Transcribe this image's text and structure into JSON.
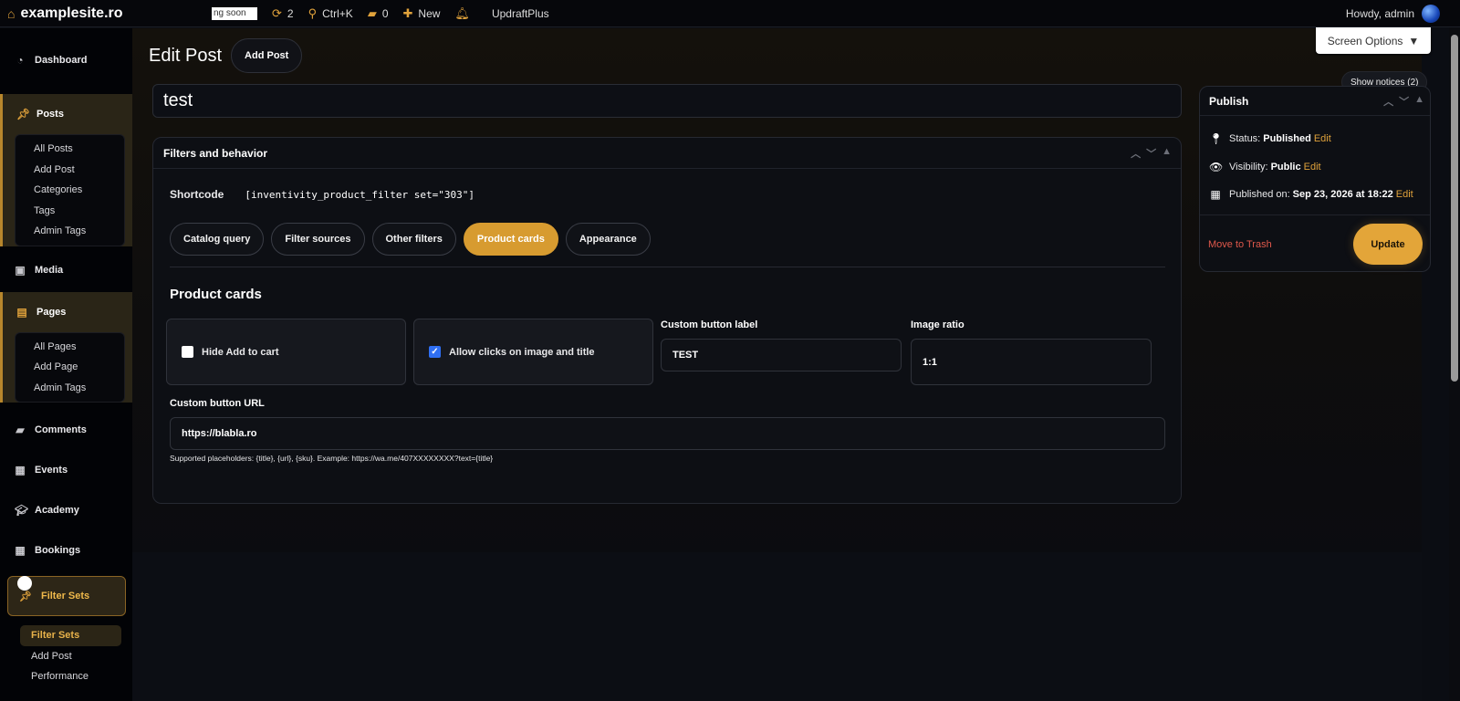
{
  "adminbar": {
    "site_name": "examplesite.ro",
    "coming_soon": "ng soon",
    "updates_count": "2",
    "search_shortcut": "Ctrl+K",
    "comments_count": "0",
    "new_label": "New",
    "plugin_label": "UpdraftPlus",
    "howdy": "Howdy, admin"
  },
  "sidebar": {
    "dashboard": "Dashboard",
    "posts": "Posts",
    "posts_sub": [
      "All Posts",
      "Add Post",
      "Categories",
      "Tags",
      "Admin Tags"
    ],
    "media": "Media",
    "pages": "Pages",
    "pages_sub": [
      "All Pages",
      "Add Page",
      "Admin Tags"
    ],
    "comments": "Comments",
    "events": "Events",
    "academy": "Academy",
    "bookings": "Bookings",
    "filter_sets": "Filter Sets",
    "filter_sets_sub": [
      "Filter Sets",
      "Add Post",
      "Performance"
    ]
  },
  "header": {
    "title": "Edit Post",
    "add_post": "Add Post",
    "screen_options": "Screen Options",
    "show_notices": "Show notices (2)"
  },
  "post_title": "test",
  "filters_box": {
    "title": "Filters and behavior",
    "shortcode_label": "Shortcode",
    "shortcode_value": "[inventivity_product_filter set=\"303\"]",
    "tabs": [
      "Catalog query",
      "Filter sources",
      "Other filters",
      "Product cards",
      "Appearance"
    ],
    "active_tab": "Product cards",
    "section_title": "Product cards",
    "hide_add_to_cart": "Hide Add to cart",
    "allow_clicks": "Allow clicks on image and title",
    "custom_button_label_label": "Custom button label",
    "custom_button_label_value": "TEST",
    "image_ratio_label": "Image ratio",
    "image_ratio_value": "1:1",
    "custom_button_url_label": "Custom button URL",
    "custom_button_url_value": "https://blabla.ro",
    "help_text": "Supported placeholders: {title}, {url}, {sku}. Example: https://wa.me/407XXXXXXXX?text={title}"
  },
  "publish": {
    "title": "Publish",
    "status_label": "Status:",
    "status_value": "Published",
    "visibility_label": "Visibility:",
    "visibility_value": "Public",
    "published_label": "Published on:",
    "published_value": "Sep 23, 2026 at 18:22",
    "edit": "Edit",
    "move_to_trash": "Move to Trash",
    "update": "Update"
  },
  "colors": {
    "accent": "#e0a23b",
    "trash": "#e0584b",
    "checkbox": "#2f6ff3"
  }
}
